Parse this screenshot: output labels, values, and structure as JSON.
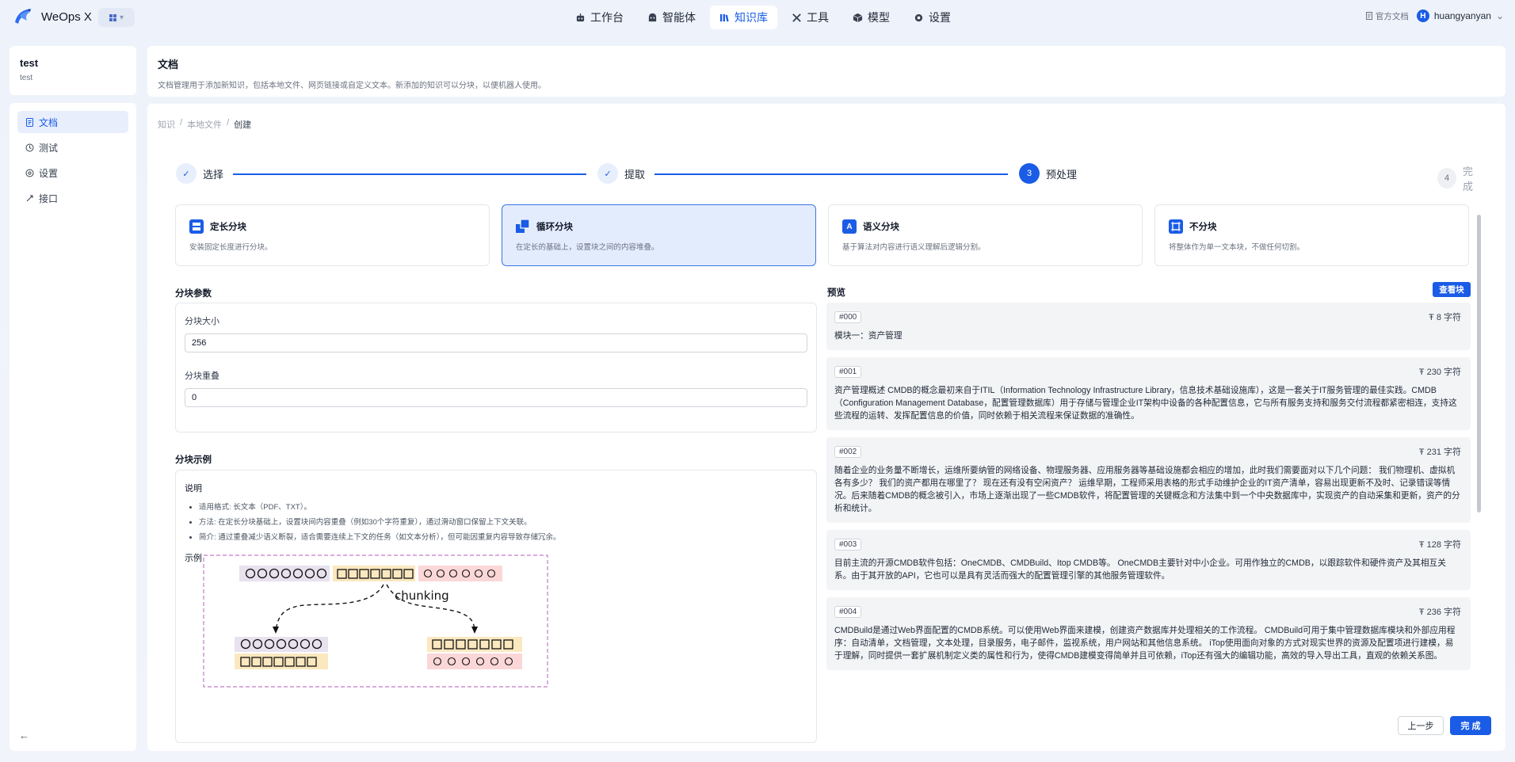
{
  "app": {
    "name": "WeOps X"
  },
  "nav": [
    {
      "label": "工作台",
      "icon": "robot-icon"
    },
    {
      "label": "智能体",
      "icon": "bot-icon"
    },
    {
      "label": "知识库",
      "icon": "library-icon",
      "active": true
    },
    {
      "label": "工具",
      "icon": "tools-icon"
    },
    {
      "label": "模型",
      "icon": "cube-icon"
    },
    {
      "label": "设置",
      "icon": "gear-icon"
    }
  ],
  "topright": {
    "doc_link": "官方文档",
    "user": "huangyanyan",
    "avatar_letter": "H"
  },
  "sidebar": {
    "title": "test",
    "subtitle": "test",
    "items": [
      {
        "label": "文档",
        "icon": "document-icon",
        "active": true
      },
      {
        "label": "测试",
        "icon": "test-icon"
      },
      {
        "label": "设置",
        "icon": "settings-icon"
      },
      {
        "label": "接口",
        "icon": "api-icon"
      }
    ]
  },
  "header": {
    "title": "文档",
    "description": "文档管理用于添加新知识，包括本地文件、网页链接或自定义文本。新添加的知识可以分块，以便机器人使用。"
  },
  "breadcrumb": [
    "知识",
    "本地文件",
    "创建"
  ],
  "steps": [
    {
      "label": "选择",
      "status": "done"
    },
    {
      "label": "提取",
      "status": "done"
    },
    {
      "label": "预处理",
      "status": "current",
      "num": "3"
    },
    {
      "label": "完成",
      "status": "todo",
      "num": "4"
    }
  ],
  "methods": [
    {
      "title": "定长分块",
      "desc": "安装固定长度进行分块。",
      "icon": "fixed-chunk-icon"
    },
    {
      "title": "循环分块",
      "desc": "在定长的基础上，设置块之间的内容堆叠。",
      "icon": "loop-chunk-icon",
      "active": true
    },
    {
      "title": "语义分块",
      "desc": "基于算法对内容进行语义理解后逻辑分割。",
      "icon": "semantic-chunk-icon"
    },
    {
      "title": "不分块",
      "desc": "将整体作为单一文本块，不做任何切割。",
      "icon": "no-chunk-icon"
    }
  ],
  "params": {
    "section_title": "分块参数",
    "size_label": "分块大小",
    "size_value": "256",
    "overlap_label": "分块重叠",
    "overlap_value": "0"
  },
  "example": {
    "section_title": "分块示例",
    "explain_title": "说明",
    "bullets": [
      "适用格式: 长文本（PDF、TXT）。",
      "方法: 在定长分块基础上，设置块间内容重叠（例如30个字符重复），通过滑动窗口保留上下文关联。",
      "简介: 通过重叠减少语义断裂，适合需要连续上下文的任务（如文本分析），但可能因重复内容导致存储冗余。"
    ],
    "example_title": "示例",
    "diagram_label": "chunking"
  },
  "preview": {
    "title": "预览",
    "button": "查看块",
    "chunks": [
      {
        "id": "#000",
        "count": "8 字符",
        "text": "模块一：资产管理"
      },
      {
        "id": "#001",
        "count": "230 字符",
        "text": "资产管理概述 CMDB的概念最初来自于ITIL（Information Technology Infrastructure Library，信息技术基础设施库），这是一套关于IT服务管理的最佳实践。CMDB（Configuration Management Database，配置管理数据库）用于存储与管理企业IT架构中设备的各种配置信息，它与所有服务支持和服务交付流程都紧密相连，支持这些流程的运转、发挥配置信息的价值，同时依赖于相关流程来保证数据的准确性。"
      },
      {
        "id": "#002",
        "count": "231 字符",
        "text": "随着企业的业务量不断增长，运维所要纳管的网络设备、物理服务器、应用服务器等基础设施都会相应的增加，此时我们需要面对以下几个问题： 我们物理机、虚拟机各有多少？ 我们的资产都用在哪里了？ 现在还有没有空闲资产？ 运维早期，工程师采用表格的形式手动维护企业的IT资产清单，容易出现更新不及时、记录错误等情况。后来随着CMDB的概念被引入，市场上逐渐出现了一些CMDB软件，将配置管理的关键概念和方法集中到一个中央数据库中，实现资产的自动采集和更新，资产的分析和统计。"
      },
      {
        "id": "#003",
        "count": "128 字符",
        "text": "目前主流的开源CMDB软件包括：OneCMDB、CMDBuild、Itop CMDB等。 OneCMDB主要针对中小企业。可用作独立的CMDB，以跟踪软件和硬件资产及其相互关系。由于其开放的API，它也可以是具有灵活而强大的配置管理引擎的其他服务管理软件。"
      },
      {
        "id": "#004",
        "count": "236 字符",
        "text": "CMDBuild是通过Web界面配置的CMDB系统。可以使用Web界面来建模，创建资产数据库并处理相关的工作流程。 CMDBuild可用于集中管理数据库模块和外部应用程序：自动清单，文档管理，文本处理，目录服务，电子邮件，监视系统，用户网站和其他信息系统。 iTop使用面向对象的方式对现实世界的资源及配置项进行建模，易于理解，同时提供一套扩展机制定义类的属性和行为，使得CMDB建模变得简单并且可依赖，iTop还有强大的编辑功能，高效的导入导出工具，直观的依赖关系图。"
      }
    ]
  },
  "footer": {
    "prev": "上一步",
    "done": "完 成"
  },
  "colors": {
    "primary": "#1a5ce6",
    "active_card_bg": "#e3ecfd"
  }
}
